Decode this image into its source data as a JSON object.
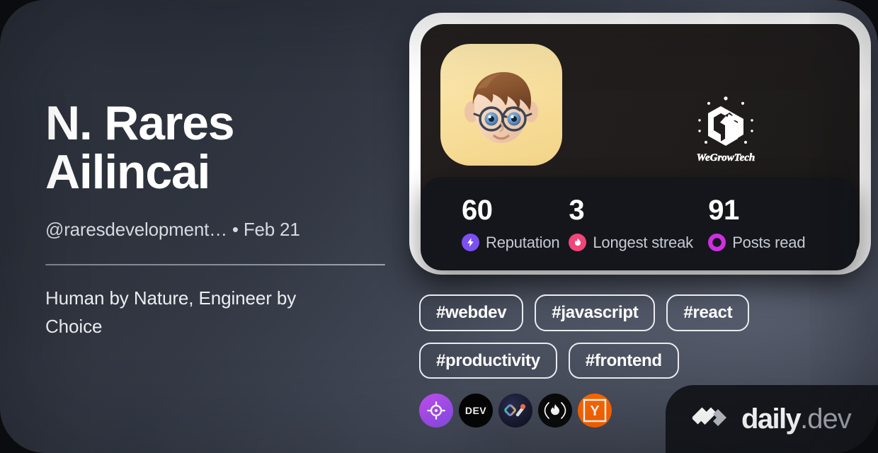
{
  "profile": {
    "name": "N. Rares Ailincai",
    "handle": "@raresdevelopment…",
    "separator": "•",
    "joined": "Feb 21",
    "bio": "Human by Nature, Engineer by Choice"
  },
  "stats": [
    {
      "value": "60",
      "label": "Reputation",
      "icon": "reputation-bolt-icon",
      "color": "#7b4ff0"
    },
    {
      "value": "3",
      "label": "Longest streak",
      "icon": "streak-flame-icon",
      "color": "#f0467a"
    },
    {
      "value": "91",
      "label": "Posts read",
      "icon": "posts-read-icon",
      "color": "#cf2fe0"
    }
  ],
  "tags": [
    {
      "label": "#webdev"
    },
    {
      "label": "#javascript"
    },
    {
      "label": "#react"
    },
    {
      "label": "#productivity"
    },
    {
      "label": "#frontend"
    }
  ],
  "sources": [
    {
      "name": "target-source-icon",
      "title": ""
    },
    {
      "name": "dev-to-source-icon",
      "title": "DEV"
    },
    {
      "name": "daily-source-icon",
      "title": ""
    },
    {
      "name": "flame-source-icon",
      "title": ""
    },
    {
      "name": "hacker-news-source-icon",
      "title": "Y"
    }
  ],
  "brand": {
    "company_logo_text": "WeGrowTech",
    "watermark_primary": "daily",
    "watermark_suffix": ".dev"
  },
  "colors": {
    "accent_purple": "#7b4ff0",
    "accent_pink": "#f0467a",
    "accent_magenta": "#cf2fe0",
    "card_border": "#ffffff",
    "card_bg": "#241f1e",
    "stats_bg": "#14161b",
    "yc_orange": "#ff6600"
  }
}
